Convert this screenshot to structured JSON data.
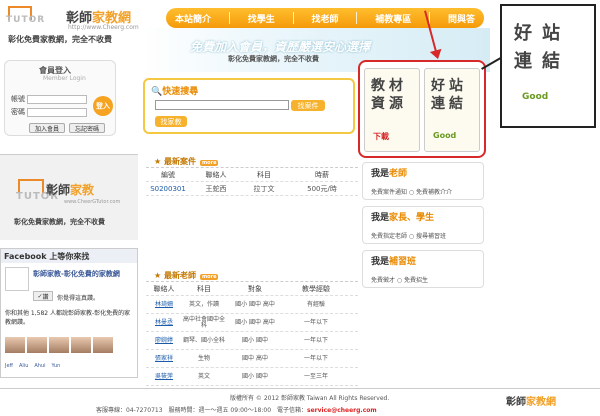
{
  "header": {
    "logo_brand_a": "彰師",
    "logo_brand_b": "家教網",
    "logo_tutor": "TUTOR",
    "logo_domain": "http://www.Cheerg.com",
    "slogan": "彰化免費家教網，完全不收費",
    "nav": [
      "本站簡介",
      "找學生",
      "找老師",
      "補教專區",
      "問與答"
    ],
    "banner": "免費加入會員，資歷嚴選安心選擇",
    "banner_sub": "彰化免費家教網，完全不收費"
  },
  "login": {
    "title": "會員登入",
    "subtitle": "Member Login",
    "account_label": "帳號",
    "password_label": "密碼",
    "go": "登入",
    "join": "加入會員",
    "forgot": "忘記密碼"
  },
  "quick_search": {
    "title": "快速搜尋",
    "find_case": "找案件",
    "find_tutor": "找家教"
  },
  "links": {
    "left_chars": [
      "教",
      "材",
      "資",
      "源"
    ],
    "right_chars": [
      "好",
      "站",
      "連",
      "結"
    ],
    "download": "下載",
    "good": "Good",
    "callout_chars": [
      "好",
      "站",
      "連",
      "結"
    ],
    "callout_good": "Good"
  },
  "roles": [
    {
      "a": "我是",
      "b": "老師",
      "sub": "免費案件通知 ○ 免費補教介介"
    },
    {
      "a": "我是",
      "b": "家長、學生",
      "sub": "免費指定老師 ○ 搜尋補習班"
    },
    {
      "a": "我是",
      "b": "補習班",
      "sub": "免費徵才 ○ 免費招生"
    }
  ],
  "tutorbox": {
    "brand_a": "彰師",
    "brand_b": "家教",
    "tutor": "TUTOR",
    "domain": "www.CheerGTutor.com",
    "slogan": "彰化免費家教網，完全不收費"
  },
  "facebook": {
    "header": "Facebook 上等你來找",
    "page_name": "彰師家教-彰化免費的家教網",
    "like": "讚",
    "like_text": "你覺得這真讚。",
    "count_text": "你和其他 1,582 人都說彰師家教-彰化免費的家教網讚。",
    "names": [
      "Jeff",
      "Aliu",
      "Ahui",
      "Yun"
    ]
  },
  "cases": {
    "title": "最新案件",
    "more": "more",
    "headers": [
      "編號",
      "聯絡人",
      "科目",
      "時薪"
    ],
    "rows": [
      [
        "S0200301",
        "王蛇西",
        "拉丁文",
        "500元/時"
      ]
    ]
  },
  "teachers": {
    "title": "最新老師",
    "more": "more",
    "headers": [
      "聯絡人",
      "科目",
      "對象",
      "教學經驗"
    ],
    "rows": [
      [
        "林琦姍",
        "英文，作讀",
        "國小 國中 高中",
        "有經驗"
      ],
      [
        "林曼丞",
        "高中社會國中全科",
        "國小 國中 高中",
        "一年以下"
      ],
      [
        "廖婉婷",
        "鋼琴、國小全科",
        "國小 國中",
        "一年以下"
      ],
      [
        "張家祥",
        "生物",
        "國中 高中",
        "一年以下"
      ],
      [
        "吳筱萍",
        "英文",
        "國小 國中",
        "一至三年"
      ]
    ]
  },
  "footer": {
    "copyright": "版權所有 © 2012 彰師家教 Taiwan All Rights Reserved.",
    "contact_a": "客服專線：04-7270713　服務時間：週一～週五 09:00～18:00　電子信箱：",
    "email": "service@cheerg.com",
    "logo_a": "彰師",
    "logo_b": "家教網"
  }
}
